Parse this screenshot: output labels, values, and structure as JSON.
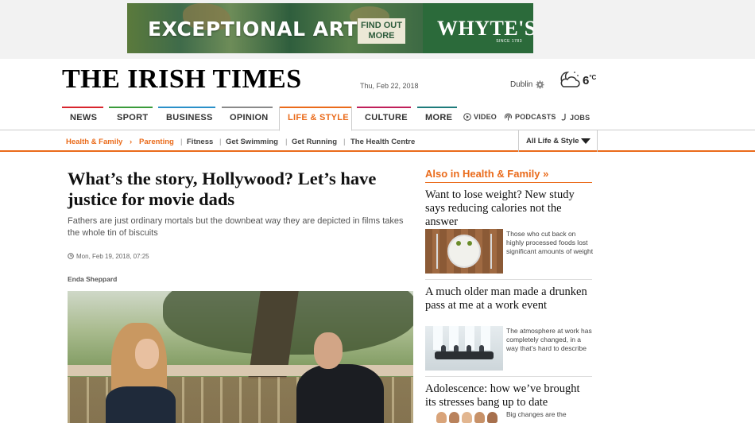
{
  "ad": {
    "headline": "EXCEPTIONAL ART",
    "cta_line1": "FIND OUT",
    "cta_line2": "MORE",
    "brand": "WHYTE'S",
    "brand_since": "SINCE 1783"
  },
  "masthead": {
    "logo": "THE IRISH TIMES",
    "date": "Thu, Feb 22, 2018",
    "weather": {
      "city": "Dublin",
      "temp": "6",
      "unit": "°C",
      "icon": "partly-cloudy-night-icon"
    }
  },
  "nav": {
    "tabs": [
      {
        "label": "NEWS",
        "color": "#d8262e"
      },
      {
        "label": "SPORT",
        "color": "#3a9b3a"
      },
      {
        "label": "BUSINESS",
        "color": "#2a90c8"
      },
      {
        "label": "OPINION",
        "color": "#8a8a8a"
      },
      {
        "label": "LIFE & STYLE",
        "color": "#ea6b1b",
        "active": true
      },
      {
        "label": "CULTURE",
        "color": "#c0205a"
      },
      {
        "label": "MORE",
        "color": "#1e7b7b"
      }
    ],
    "extras": [
      {
        "label": "VIDEO",
        "icon": "play-icon"
      },
      {
        "label": "PODCASTS",
        "icon": "podcast-icon"
      },
      {
        "label": "JOBS",
        "icon": "jobs-icon"
      }
    ]
  },
  "subnav": {
    "section": "Health & Family",
    "current": "Parenting",
    "links": [
      "Fitness",
      "Get Swimming",
      "Get Running",
      "The Health Centre"
    ],
    "dropdown": "All Life & Style"
  },
  "article": {
    "title": "What’s the story, Hollywood? Let’s have justice for movie dads",
    "standfirst": "Fathers are just ordinary mortals but the downbeat way they are depicted in films takes the whole tin of biscuits",
    "timestamp": "Mon, Feb 19, 2018, 07:25",
    "author": "Enda Sheppard"
  },
  "sidebar": {
    "heading": "Also in Health & Family »",
    "items": [
      {
        "title": "Want to lose weight? New study says reducing calories not the answer",
        "desc": "Those who cut back on highly processed foods lost significant amounts of weight"
      },
      {
        "title": "A much older man made a drunken pass at me at a work event",
        "desc": "The atmosphere at work has completely changed, in a way that’s hard to describe"
      },
      {
        "title": "Adolescence: how we’ve brought its stresses bang up to date",
        "desc": "Big changes are the"
      }
    ]
  },
  "colors": {
    "accent": "#ea6b1b",
    "ad_green": "#2b6a3a"
  }
}
